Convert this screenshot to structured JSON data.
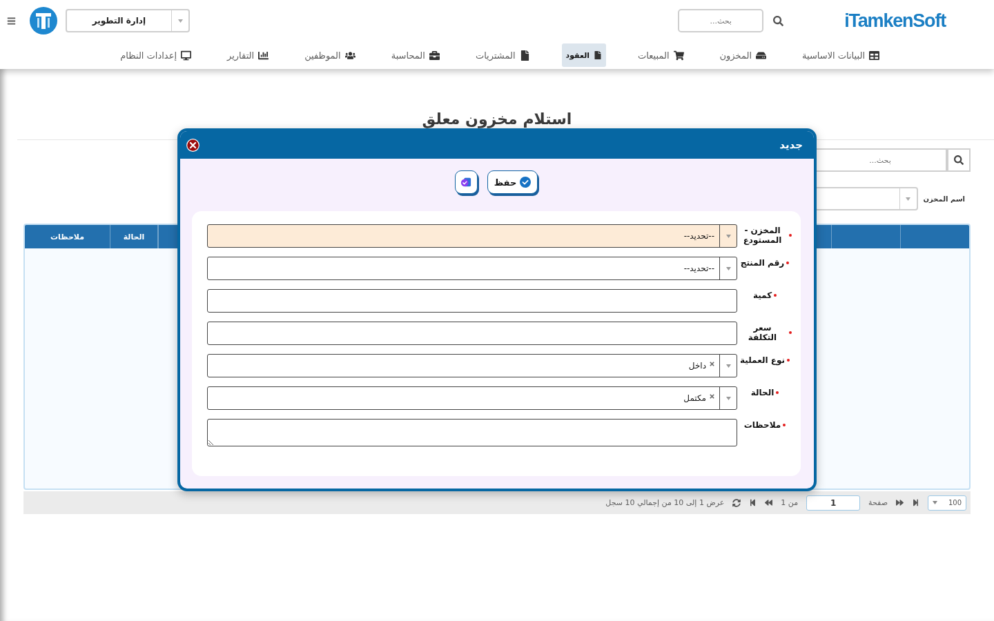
{
  "header": {
    "brand": "iTamkenSoft",
    "search": {
      "placeholder": "بحث..."
    },
    "department": {
      "value": "إدارة التطوير"
    }
  },
  "nav": [
    {
      "label": "البيانات الاساسية",
      "selected": false
    },
    {
      "label": "المخزون",
      "selected": false
    },
    {
      "label": "المبيعات",
      "selected": false
    },
    {
      "label": "العقود",
      "selected": true
    },
    {
      "label": "المشتريات",
      "selected": false
    },
    {
      "label": "المحاسبة",
      "selected": false
    },
    {
      "label": "الموظفين",
      "selected": false
    },
    {
      "label": "التقارير",
      "selected": false
    },
    {
      "label": "إعدادات النظام",
      "selected": false
    }
  ],
  "page": {
    "title": "استلام مخزون معلق",
    "search": {
      "placeholder": "بحث..."
    },
    "filter": {
      "label": "اسم المخزن"
    },
    "table": {
      "columns": [
        "الحالة",
        "ملاحظات"
      ]
    },
    "pagination": {
      "page_size": "100",
      "page_label": "صفحة",
      "page": "1",
      "page_count": "من 1",
      "summary": "عرض 1 إلى 10 من إجمالي 10 سجل"
    }
  },
  "dialog": {
    "title": "جديد",
    "buttons": [
      {
        "kind": "save",
        "label": "حفظ"
      },
      {
        "kind": "icon"
      }
    ],
    "fields": [
      {
        "kind": "select",
        "label": "المخزن - المستودع",
        "required": true,
        "value": "--تحديد--",
        "highlighted": true,
        "clearable": false
      },
      {
        "kind": "select",
        "label": "رقم المنتج",
        "required": true,
        "value": "--تحديد--",
        "highlighted": false,
        "clearable": false
      },
      {
        "kind": "text",
        "label": "كمية",
        "required": true
      },
      {
        "kind": "text",
        "label": "سعر التكلفة",
        "required": true
      },
      {
        "kind": "select",
        "label": "نوع العملية",
        "required": true,
        "value": "داخل",
        "highlighted": false,
        "clearable": true
      },
      {
        "kind": "select",
        "label": "الحالة",
        "required": true,
        "value": "مكتمل",
        "highlighted": false,
        "clearable": true
      },
      {
        "kind": "textarea",
        "label": "ملاحظات",
        "required": true
      }
    ]
  }
}
